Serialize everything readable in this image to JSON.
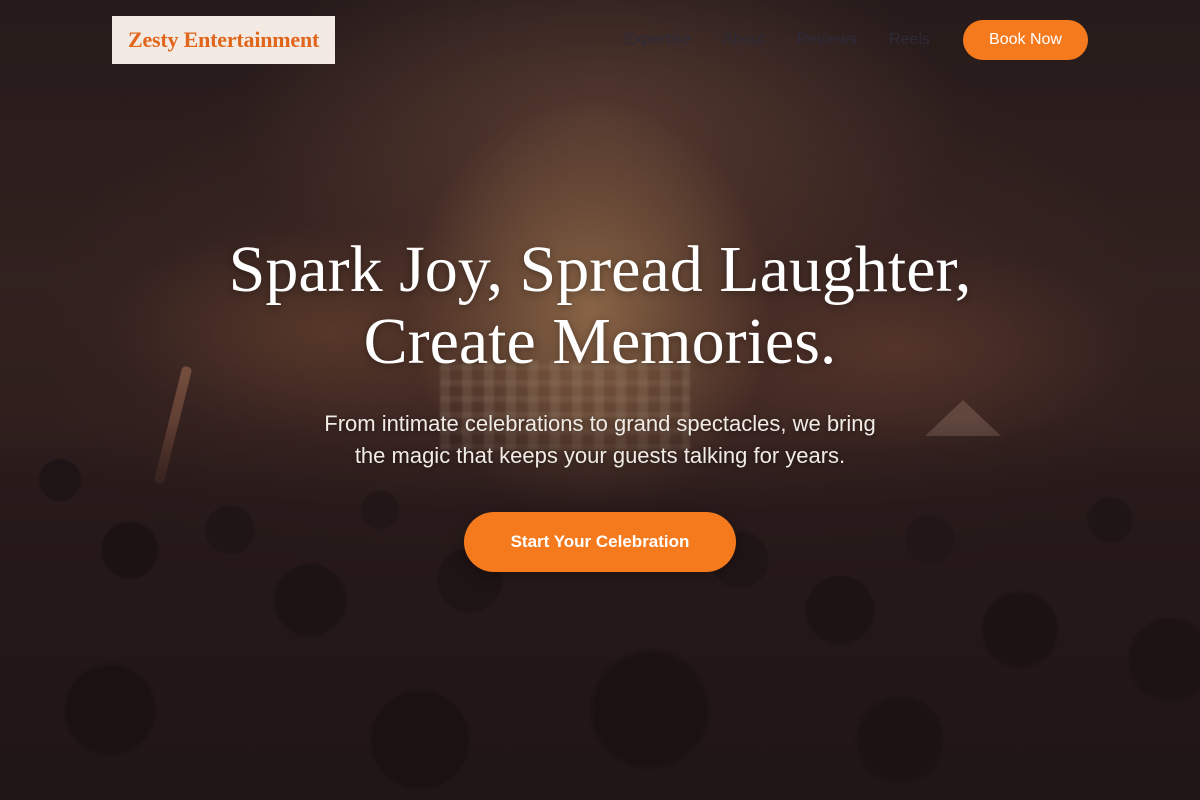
{
  "brand": {
    "name": "Zesty Entertainment",
    "accent_color": "#f57a1e"
  },
  "nav": {
    "items": [
      {
        "label": "Expertise"
      },
      {
        "label": "About"
      },
      {
        "label": "Reviews"
      },
      {
        "label": "Reels"
      }
    ],
    "cta_label": "Book Now"
  },
  "hero": {
    "headline_line1": "Spark Joy, Spread Laughter,",
    "headline_line2": "Create Memories.",
    "subtext_line1": "From intimate celebrations to grand spectacles, we bring",
    "subtext_line2": "the magic that keeps your guests talking for years.",
    "cta_label": "Start Your Celebration",
    "background": "concert crowd with stage lights"
  }
}
